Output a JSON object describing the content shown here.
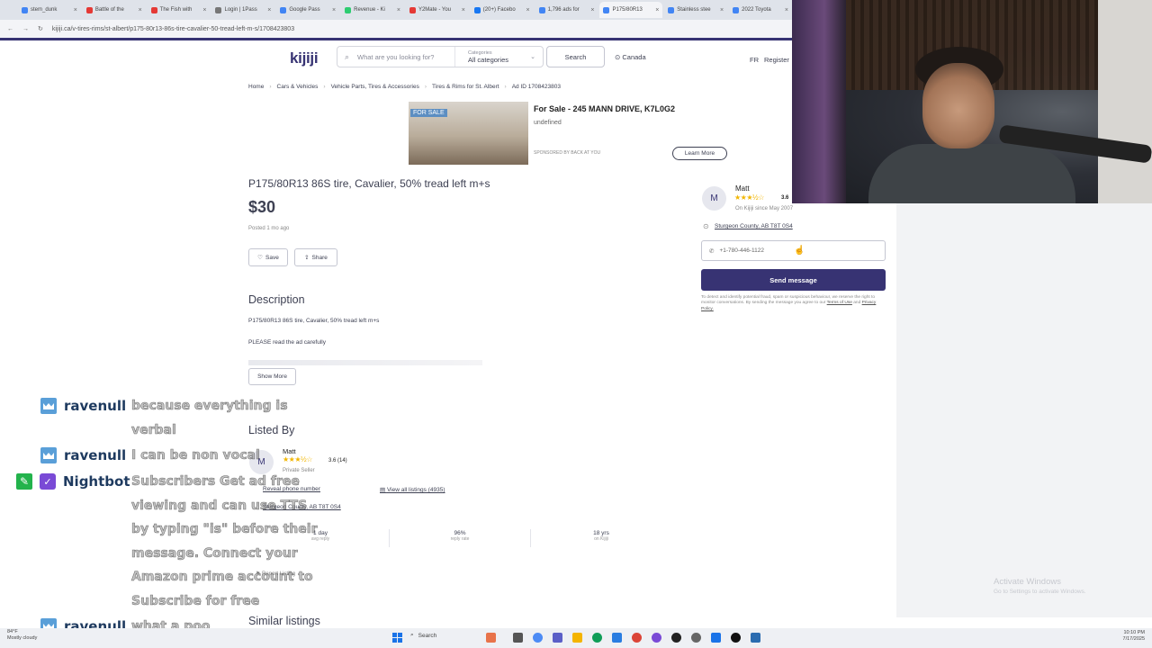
{
  "browser": {
    "tabs": [
      {
        "label": "stem_dunk"
      },
      {
        "label": "Battle of the"
      },
      {
        "label": "The Fish with"
      },
      {
        "label": "Login | 1Pass"
      },
      {
        "label": "Google Pass"
      },
      {
        "label": "Revenue - Ki"
      },
      {
        "label": "Y2Mate - You"
      },
      {
        "label": "(20+) Facebo"
      },
      {
        "label": "1,796 ads for"
      },
      {
        "label": "P175/80R13"
      },
      {
        "label": "Stainless stee"
      },
      {
        "label": "2022 Toyota"
      }
    ],
    "url": "kijiji.ca/v-tires-rims/st-albert/p175-80r13-86s-tire-cavalier-50-tread-left-m-s/1708423803"
  },
  "header": {
    "logo": "kijiji",
    "search_placeholder": "What are you looking for?",
    "categories_label": "Categories",
    "categories_value": "All categories",
    "search_button": "Search",
    "location": "Canada",
    "lang": "FR",
    "register": "Register"
  },
  "breadcrumb": [
    "Home",
    "Cars & Vehicles",
    "Vehicle Parts, Tires & Accessories",
    "Tires & Rims for St. Albert",
    "Ad ID 1708423803"
  ],
  "ad": {
    "badge": "FOR SALE",
    "title": "For Sale - 245 MANN DRIVE, K7L0G2",
    "subtitle": "undefined",
    "sponsored": "SPONSORED BY BACK AT YOU",
    "learn_more": "Learn More"
  },
  "listing": {
    "title": "P175/80R13 86S tire, Cavalier, 50% tread left m+s",
    "price": "$30",
    "posted": "Posted 1 mo ago",
    "save": "Save",
    "share": "Share",
    "description_heading": "Description",
    "description_line1": "P175/80R13 86S tire, Cavalier, 50% tread left m+s",
    "description_line2": "PLEASE read the ad carefully",
    "show_more": "Show More"
  },
  "seller": {
    "initial": "M",
    "name": "Matt",
    "stars": "★★★½☆",
    "rating": "3.6",
    "since": "On Kijiji since May 2007",
    "address": "Sturgeon County, AB T8T 0S4",
    "phone": "+1-780-446-1122",
    "send_message": "Send message",
    "disclaimer": "To detect and identify potential fraud, spam or suspicious behaviour, we reserve the right to monitor conversations. By sending the message you agree to our",
    "terms": "Terms of Use",
    "and": "and",
    "privacy": "Privacy Policy."
  },
  "listed_by": {
    "heading": "Listed By",
    "initial": "M",
    "name": "Matt",
    "stars": "★★★½☆",
    "rating": "3.6 (14)",
    "type": "Private Seller",
    "reveal_phone": "Reveal phone number",
    "view_listings": "View all listings (4935)",
    "address": "Sturgeon County, AB T8T 0S4",
    "stats": [
      {
        "value": "1 day",
        "label": "avg reply"
      },
      {
        "value": "96%",
        "label": "reply rate"
      },
      {
        "value": "18 yrs",
        "label": "on Kijiji"
      }
    ],
    "report": "Report Listing"
  },
  "similar_heading": "Similar listings",
  "chat": [
    {
      "user": "ravenull",
      "message": "because everything is verbal"
    },
    {
      "user": "ravenull",
      "message": "I can be non vocal"
    },
    {
      "user": "Nightbot",
      "message": "Subscribers Get ad free viewing and can use TTS by typing \"is\" before their message. Connect your Amazon prime account to Subscribe for free"
    },
    {
      "user": "ravenull",
      "message": "what a poo"
    }
  ],
  "windows_notice": {
    "title": "Activate Windows",
    "sub": "Go to Settings to activate Windows."
  },
  "taskbar": {
    "weather_temp": "84°F",
    "weather_desc": "Mostly cloudy",
    "search": "Search",
    "time": "10:10 PM",
    "date": "7/17/2025"
  }
}
